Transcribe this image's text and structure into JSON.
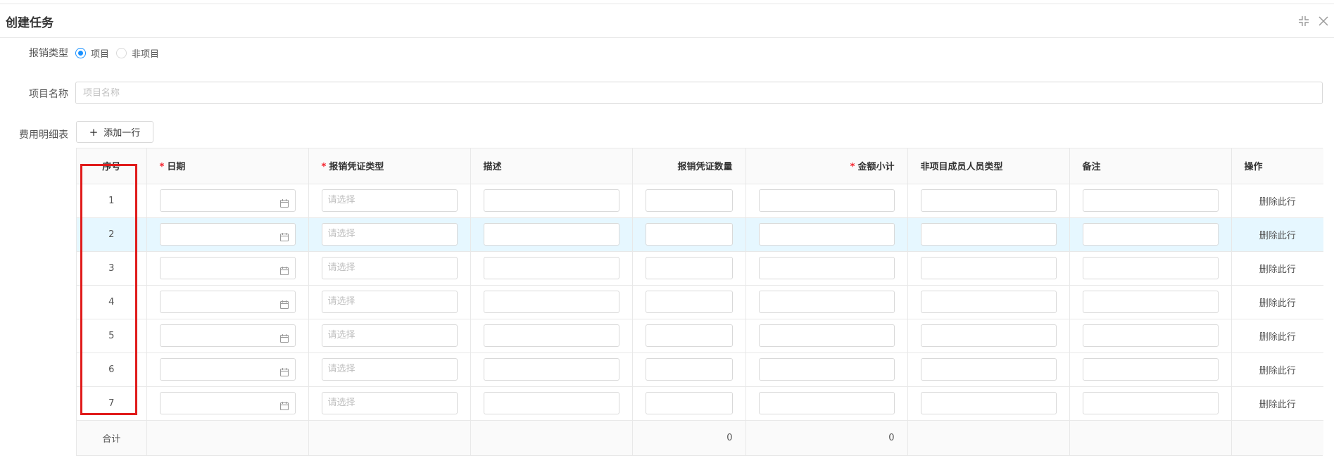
{
  "dialog": {
    "title": "创建任务",
    "icons": {
      "collapse": "compress-icon",
      "close": "close-icon"
    }
  },
  "form": {
    "reimburse_type_label": "报销类型",
    "reimburse_type_options": [
      {
        "label": "项目",
        "checked": true
      },
      {
        "label": "非项目",
        "checked": false
      }
    ],
    "project_name_label": "项目名称",
    "project_name_placeholder": "项目名称",
    "project_name_value": "",
    "expense_detail_label": "费用明细表",
    "add_row_label": "添加一行"
  },
  "table": {
    "columns": [
      {
        "label": "序号",
        "required": false
      },
      {
        "label": "日期",
        "required": true
      },
      {
        "label": "报销凭证类型",
        "required": true
      },
      {
        "label": "描述",
        "required": false
      },
      {
        "label": "报销凭证数量",
        "required": false
      },
      {
        "label": "金额小计",
        "required": true
      },
      {
        "label": "非项目成员人员类型",
        "required": false
      },
      {
        "label": "备注",
        "required": false
      },
      {
        "label": "操作",
        "required": false
      }
    ],
    "select_placeholder": "请选择",
    "delete_label": "删除此行",
    "rows": [
      {
        "index": "1",
        "highlighted": false
      },
      {
        "index": "2",
        "highlighted": true
      },
      {
        "index": "3",
        "highlighted": false
      },
      {
        "index": "4",
        "highlighted": false
      },
      {
        "index": "5",
        "highlighted": false
      },
      {
        "index": "6",
        "highlighted": false
      },
      {
        "index": "7",
        "highlighted": false
      }
    ],
    "total": {
      "label": "合计",
      "voucher_count": "0",
      "amount": "0"
    }
  },
  "colors": {
    "accent": "#1890ff",
    "required": "#f5222d",
    "highlight_row": "#e6f7ff",
    "annotation_box": "#e01b1b"
  }
}
